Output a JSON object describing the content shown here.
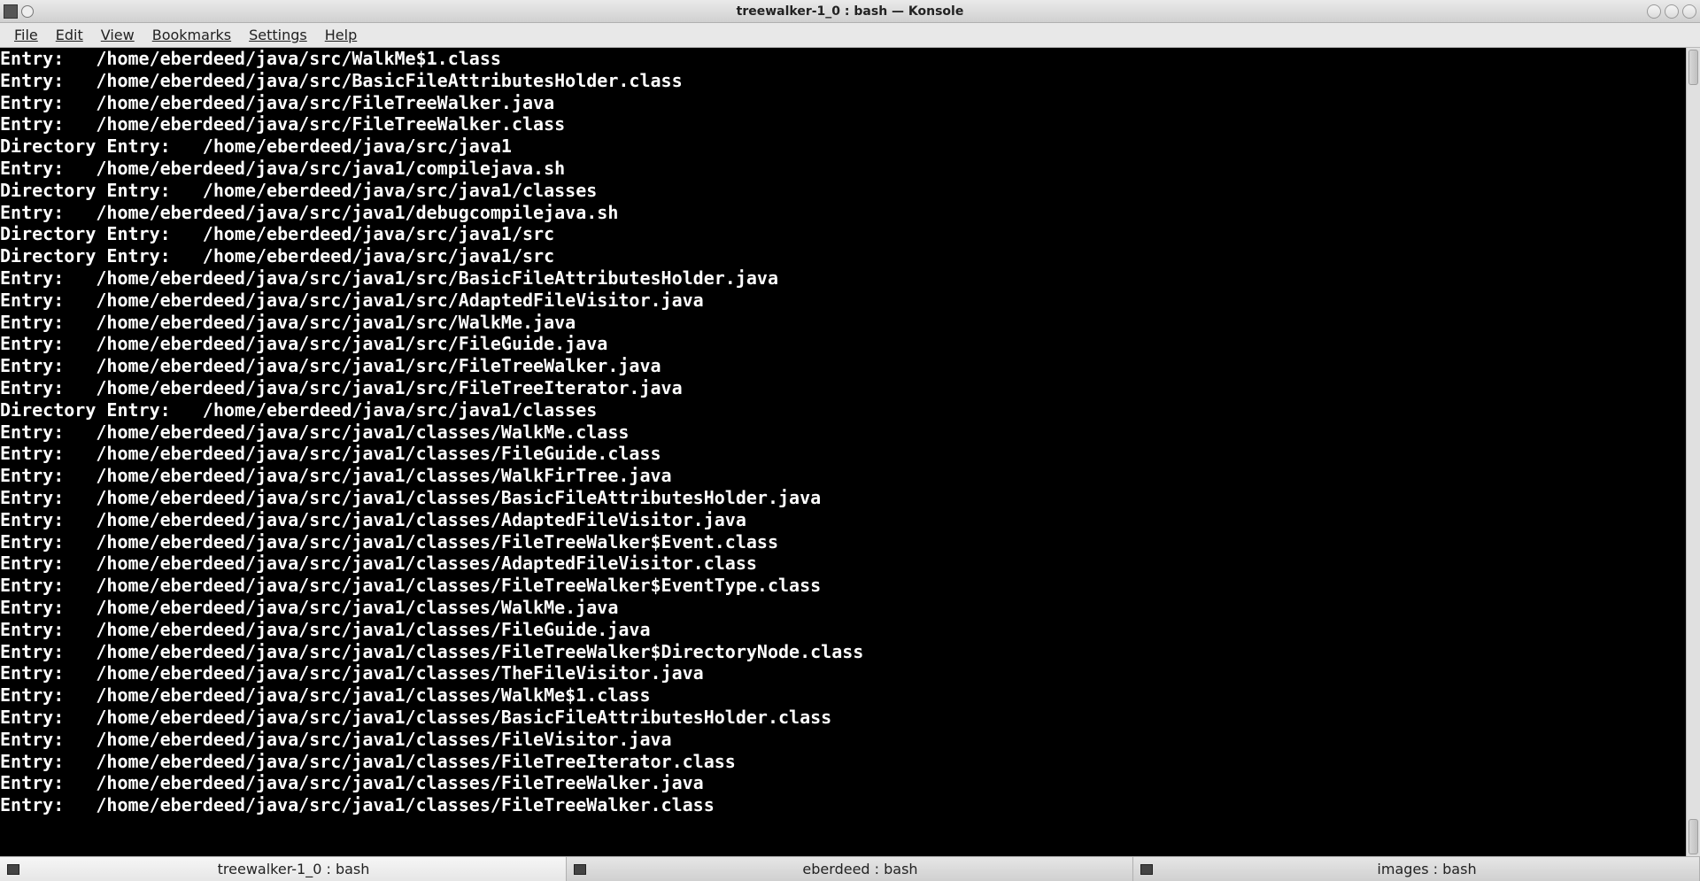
{
  "window": {
    "title": "treewalker-1_0 : bash — Konsole"
  },
  "menu": {
    "file": "File",
    "edit": "Edit",
    "view": "View",
    "bookmarks": "Bookmarks",
    "settings": "Settings",
    "help": "Help"
  },
  "terminal_lines": [
    "Entry:   /home/eberdeed/java/src/WalkMe$1.class",
    "Entry:   /home/eberdeed/java/src/BasicFileAttributesHolder.class",
    "Entry:   /home/eberdeed/java/src/FileTreeWalker.java",
    "Entry:   /home/eberdeed/java/src/FileTreeWalker.class",
    "Directory Entry:   /home/eberdeed/java/src/java1",
    "Entry:   /home/eberdeed/java/src/java1/compilejava.sh",
    "Directory Entry:   /home/eberdeed/java/src/java1/classes",
    "Entry:   /home/eberdeed/java/src/java1/debugcompilejava.sh",
    "Directory Entry:   /home/eberdeed/java/src/java1/src",
    "Directory Entry:   /home/eberdeed/java/src/java1/src",
    "Entry:   /home/eberdeed/java/src/java1/src/BasicFileAttributesHolder.java",
    "Entry:   /home/eberdeed/java/src/java1/src/AdaptedFileVisitor.java",
    "Entry:   /home/eberdeed/java/src/java1/src/WalkMe.java",
    "Entry:   /home/eberdeed/java/src/java1/src/FileGuide.java",
    "Entry:   /home/eberdeed/java/src/java1/src/FileTreeWalker.java",
    "Entry:   /home/eberdeed/java/src/java1/src/FileTreeIterator.java",
    "Directory Entry:   /home/eberdeed/java/src/java1/classes",
    "Entry:   /home/eberdeed/java/src/java1/classes/WalkMe.class",
    "Entry:   /home/eberdeed/java/src/java1/classes/FileGuide.class",
    "Entry:   /home/eberdeed/java/src/java1/classes/WalkFirTree.java",
    "Entry:   /home/eberdeed/java/src/java1/classes/BasicFileAttributesHolder.java",
    "Entry:   /home/eberdeed/java/src/java1/classes/AdaptedFileVisitor.java",
    "Entry:   /home/eberdeed/java/src/java1/classes/FileTreeWalker$Event.class",
    "Entry:   /home/eberdeed/java/src/java1/classes/AdaptedFileVisitor.class",
    "Entry:   /home/eberdeed/java/src/java1/classes/FileTreeWalker$EventType.class",
    "Entry:   /home/eberdeed/java/src/java1/classes/WalkMe.java",
    "Entry:   /home/eberdeed/java/src/java1/classes/FileGuide.java",
    "Entry:   /home/eberdeed/java/src/java1/classes/FileTreeWalker$DirectoryNode.class",
    "Entry:   /home/eberdeed/java/src/java1/classes/TheFileVisitor.java",
    "Entry:   /home/eberdeed/java/src/java1/classes/WalkMe$1.class",
    "Entry:   /home/eberdeed/java/src/java1/classes/BasicFileAttributesHolder.class",
    "Entry:   /home/eberdeed/java/src/java1/classes/FileVisitor.java",
    "Entry:   /home/eberdeed/java/src/java1/classes/FileTreeIterator.class",
    "Entry:   /home/eberdeed/java/src/java1/classes/FileTreeWalker.java",
    "Entry:   /home/eberdeed/java/src/java1/classes/FileTreeWalker.class"
  ],
  "tabs": [
    {
      "label": "treewalker-1_0 : bash",
      "active": true
    },
    {
      "label": "eberdeed : bash",
      "active": false
    },
    {
      "label": "images : bash",
      "active": false
    }
  ]
}
